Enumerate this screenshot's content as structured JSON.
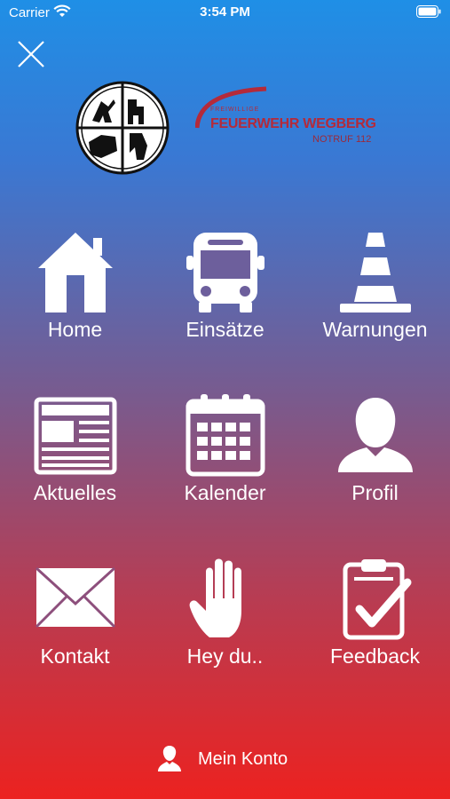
{
  "status_bar": {
    "carrier": "Carrier",
    "time": "3:54 PM",
    "wifi_icon": "wifi-icon",
    "battery_icon": "battery-icon"
  },
  "header": {
    "close_icon": "close-icon",
    "logo": {
      "small_text": "FREIWILLIGE",
      "main_text": "FEUERWEHR WEGBERG",
      "sub_text": "NOTRUF 112",
      "brand_color": "#b42a3a"
    }
  },
  "menu": {
    "items": [
      {
        "label": "Home",
        "icon": "home-icon"
      },
      {
        "label": "Einsätze",
        "icon": "bus-icon"
      },
      {
        "label": "Warnungen",
        "icon": "traffic-cone-icon"
      },
      {
        "label": "Aktuelles",
        "icon": "newspaper-icon"
      },
      {
        "label": "Kalender",
        "icon": "calendar-icon"
      },
      {
        "label": "Profil",
        "icon": "person-icon"
      },
      {
        "label": "Kontakt",
        "icon": "envelope-icon"
      },
      {
        "label": "Hey du..",
        "icon": "hand-icon"
      },
      {
        "label": "Feedback",
        "icon": "clipboard-check-icon"
      }
    ]
  },
  "footer": {
    "account_label": "Mein Konto",
    "account_icon": "person-icon"
  },
  "colors": {
    "gradient_top": "#1f8fe6",
    "gradient_bottom": "#ec2220",
    "foreground": "#ffffff"
  }
}
